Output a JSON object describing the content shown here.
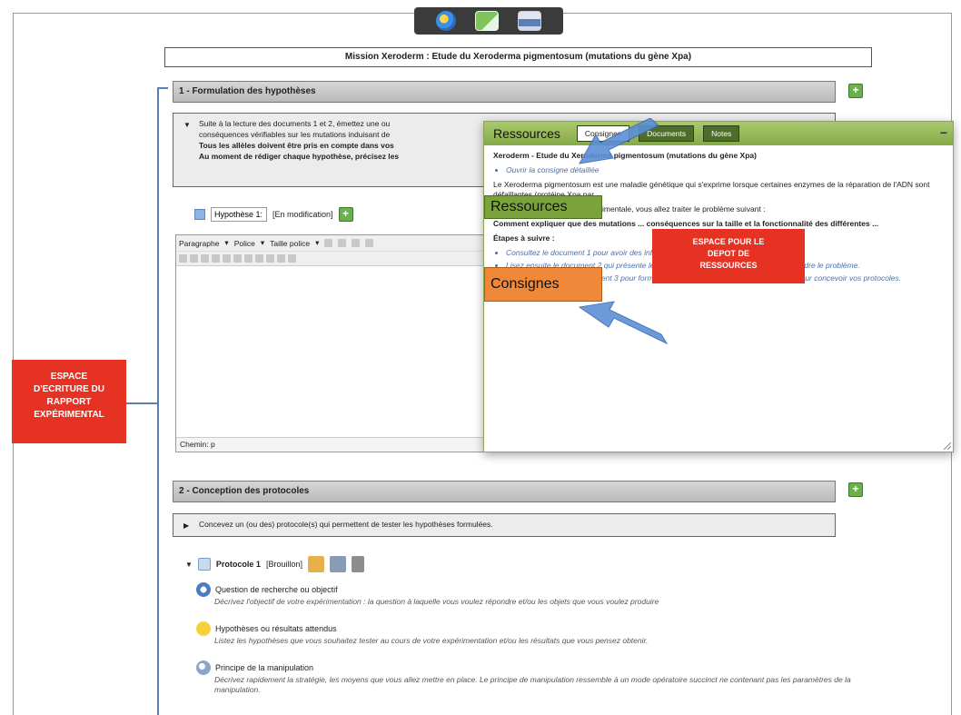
{
  "toolbar": {
    "icons": [
      "globe-icon",
      "export-icon",
      "print-icon"
    ]
  },
  "mission_title": "Mission Xeroderm : Etude du Xeroderma pigmentosum (mutations du gène Xpa)",
  "section1": {
    "title": "1 - Formulation des hypothèses",
    "instruction_line1": "Suite à la lecture des documents 1 et 2, émettez une ou",
    "instruction_line2": "conséquences vérifiables sur les mutations induisant de",
    "instruction_bold1": "Tous les allèles doivent être pris en compte dans vos",
    "instruction_bold2": "Au moment de rédiger chaque hypothèse, précisez les"
  },
  "hypothesis": {
    "input_value": "Hypothèse 1:",
    "status": "[En modification]"
  },
  "editor": {
    "format_select": "Paragraphe",
    "font_select": "Police",
    "size_select": "Taille police",
    "path_label": "Chemin: p"
  },
  "resources_panel": {
    "title": "Ressources",
    "tabs": [
      "Consignes",
      "Documents",
      "Notes"
    ],
    "close": "−",
    "heading": "Xeroderm - Etude du Xeroderma pigmentosum (mutations du gène Xpa)",
    "link": "Ouvrir la consigne détaillée",
    "para1": "Le Xeroderma pigmentosum est une maladie génétique qui s'exprime lorsque certaines enzymes de la réparation de l'ADN sont défaillantes (protéine Xpa par",
    "para2": "En suivant une démarche expérimentale, vous allez traiter le problème suivant :",
    "problem": "Comment expliquer que des mutations ... conséquences sur la taille et la fonctionnalité des différentes ...",
    "steps_title": "Étapes à suivre :",
    "steps": [
      "Consultez le document 1 pour avoir des informations générales sur la maladie.",
      "Lisez ensuite le document 2 qui présente les éléments à prendre en compte pour résoudre le problème.",
      "Appuyez-vous sur le document 3 pour formuler vos hypothèses et sur le document 4 pour concevoir vos protocoles."
    ]
  },
  "callouts": {
    "ressources": "Ressources",
    "consignes": "Consignes",
    "espace_depot_1": "ESPACE POUR LE",
    "espace_depot_2": "DEPOT DE",
    "espace_depot_3": "RESSOURCES",
    "espace_ecriture_1": "ESPACE",
    "espace_ecriture_2": "D'ECRITURE DU",
    "espace_ecriture_3": "RAPPORT",
    "espace_ecriture_4": "EXPÉRIMENTAL"
  },
  "section2": {
    "title": "2 - Conception des protocoles",
    "instruction": "Concevez un (ou des) protocole(s) qui permettent de tester les hypothèses formulées."
  },
  "protocol": {
    "title": "Protocole 1",
    "status": "[Brouillon]",
    "items": [
      {
        "title": "Question de recherche ou objectif",
        "desc": "Décrivez l'objectif de votre expérimentation : la question à laquelle vous voulez répondre et/ou les objets que vous voulez produire"
      },
      {
        "title": "Hypothèses ou résultats attendus",
        "desc": "Listez les hypothèses que vous souhaitez tester au cours de votre expérimentation et/ou les résultats que vous pensez obtenir."
      },
      {
        "title": "Principe de la manipulation",
        "desc": "Décrivez rapidement la stratégie, les moyens que vous allez mettre en place. Le principe de manipulation ressemble à un mode opératoire succinct ne contenant pas les paramètres de la manipulation."
      }
    ]
  },
  "colors": {
    "accent_green": "#86a948",
    "callout_red": "#e63222",
    "callout_orange": "#f0883a",
    "arrow_blue": "#5b8fd6"
  }
}
